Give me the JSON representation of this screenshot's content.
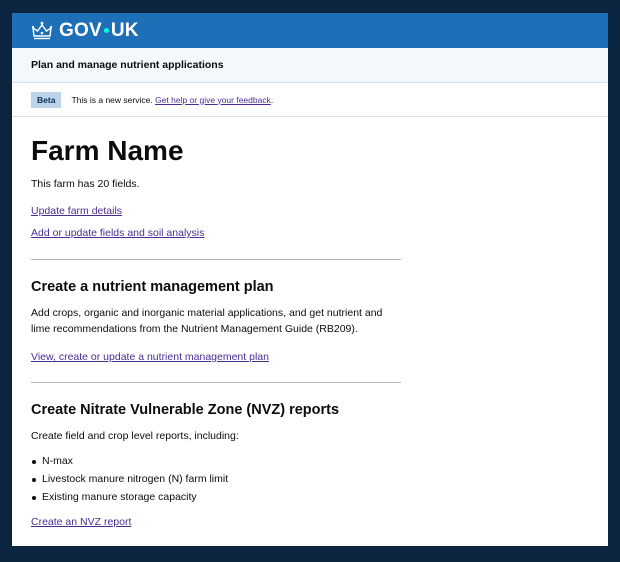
{
  "header": {
    "logo_left": "GOV",
    "logo_right": "UK",
    "crown_icon": "crown-icon",
    "brand_color": "#1d70b8"
  },
  "service": {
    "name": "Plan and manage nutrient applications"
  },
  "phase_banner": {
    "tag": "Beta",
    "text": "This is a new service.",
    "feedback_link": "Get help or give your feedback",
    "suffix": "."
  },
  "farm": {
    "name": "Farm Name",
    "fields_text": "This farm has 20 fields.",
    "update_link": "Update farm details",
    "fields_link": "Add or update fields and soil analysis"
  },
  "plan_section": {
    "heading": "Create a nutrient management plan",
    "description": "Add crops, organic and inorganic material applications, and get nutrient and lime recommendations from the Nutrient Management Guide (RB209).",
    "link": "View, create or update a nutrient management plan"
  },
  "nvz_section": {
    "heading": "Create Nitrate Vulnerable Zone (NVZ) reports",
    "description": "Create field and crop level reports, including:",
    "items": [
      "N-max",
      "Livestock manure nitrogen (N) farm limit",
      "Existing manure storage capacity"
    ],
    "link": "Create an NVZ report"
  }
}
